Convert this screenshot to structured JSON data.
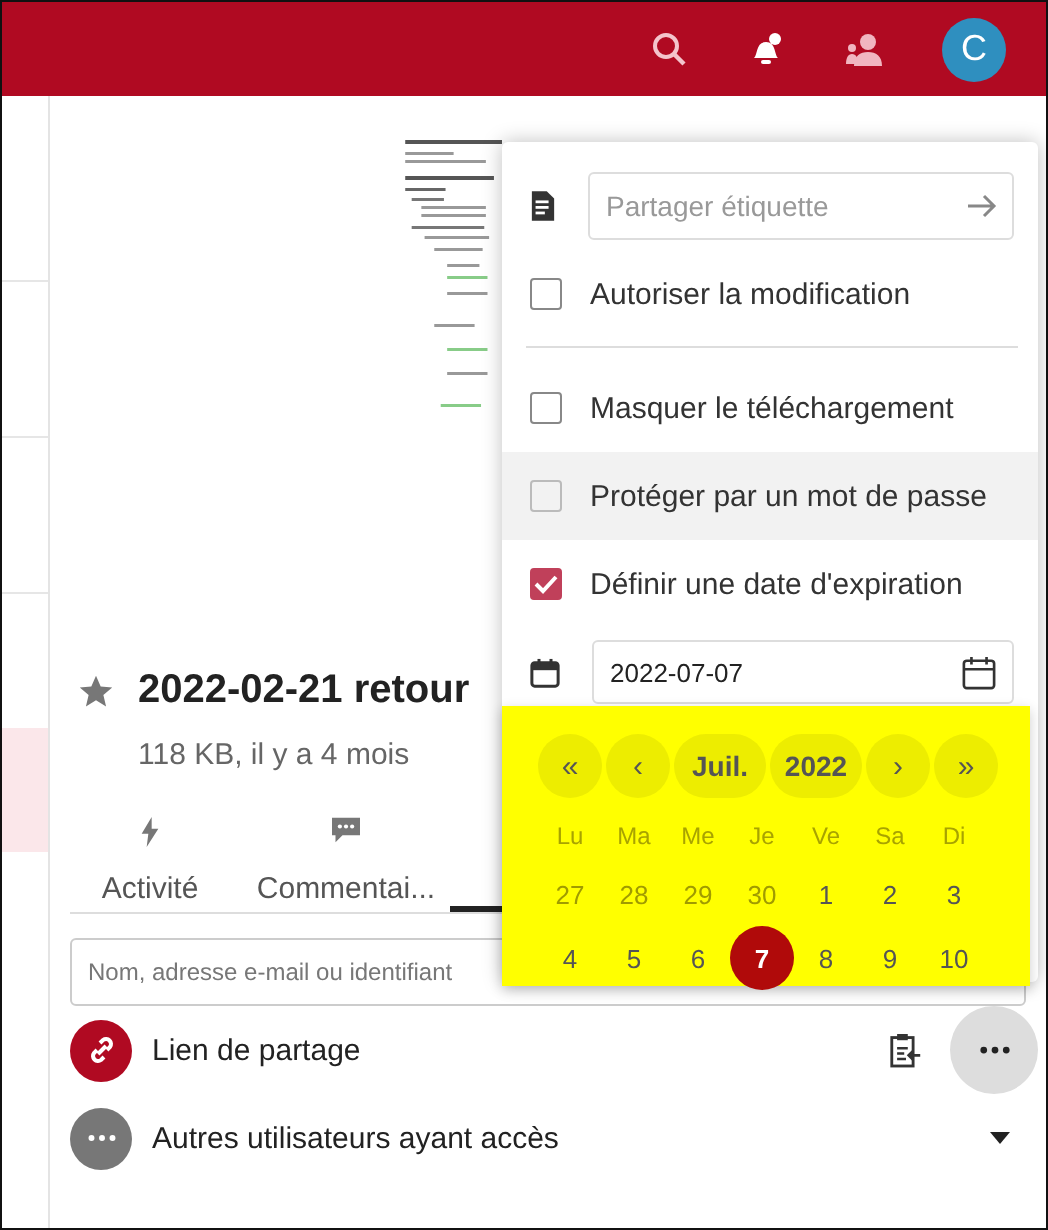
{
  "header": {
    "avatar": "C"
  },
  "file": {
    "title": "2022-02-21 retour",
    "meta": "118 KB, il y a 4 mois"
  },
  "tabs": [
    {
      "kind": "activity",
      "label": "Activité",
      "selected": false
    },
    {
      "kind": "comments",
      "label": "Commentai...",
      "selected": false
    },
    {
      "kind": "sharing",
      "selected": true
    }
  ],
  "share_search": {
    "placeholder": "Nom, adresse e-mail ou identifiant"
  },
  "shares": [
    {
      "kind": "link",
      "label": "Lien de partage"
    },
    {
      "kind": "others",
      "label": "Autres utilisateurs ayant accès"
    }
  ],
  "menu": {
    "label_field": {
      "placeholder": "Partager étiquette"
    },
    "option_groups": [
      [
        {
          "label": "Autoriser la modification",
          "checked": false,
          "highlighted": false
        }
      ],
      [
        {
          "label": "Masquer le téléchargement",
          "checked": false,
          "highlighted": false
        },
        {
          "label": "Protéger par un mot de passe",
          "checked": false,
          "highlighted": true
        },
        {
          "label": "Définir une date d'expiration",
          "checked": true,
          "highlighted": false
        }
      ]
    ],
    "expiration": {
      "value": "2022-07-07"
    }
  },
  "date_picker": {
    "nav": [
      {
        "kind": "arrow",
        "label": "«"
      },
      {
        "kind": "arrow",
        "label": "‹"
      },
      {
        "kind": "period",
        "label": "Juil."
      },
      {
        "kind": "period",
        "label": "2022"
      },
      {
        "kind": "arrow",
        "label": "›"
      },
      {
        "kind": "arrow",
        "label": "»"
      }
    ],
    "weekdays": [
      "Lu",
      "Ma",
      "Me",
      "Je",
      "Ve",
      "Sa",
      "Di"
    ],
    "days": [
      {
        "label": "27",
        "outside": true,
        "selected": false
      },
      {
        "label": "28",
        "outside": true,
        "selected": false
      },
      {
        "label": "29",
        "outside": true,
        "selected": false
      },
      {
        "label": "30",
        "outside": true,
        "selected": false
      },
      {
        "label": "1",
        "outside": false,
        "selected": false
      },
      {
        "label": "2",
        "outside": false,
        "selected": false
      },
      {
        "label": "3",
        "outside": false,
        "selected": false
      },
      {
        "label": "4",
        "outside": false,
        "selected": false
      },
      {
        "label": "5",
        "outside": false,
        "selected": false
      },
      {
        "label": "6",
        "outside": false,
        "selected": false
      },
      {
        "label": "7",
        "outside": false,
        "selected": true
      },
      {
        "label": "8",
        "outside": false,
        "selected": false
      },
      {
        "label": "9",
        "outside": false,
        "selected": false
      },
      {
        "label": "10",
        "outside": false,
        "selected": false
      }
    ]
  }
}
